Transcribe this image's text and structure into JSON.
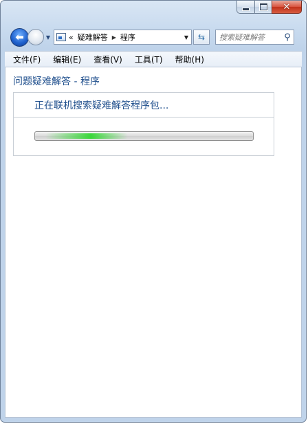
{
  "address": {
    "overflow": "«",
    "crumbs": [
      "疑难解答",
      "程序"
    ]
  },
  "search": {
    "placeholder": "搜索疑难解答"
  },
  "menu": {
    "items": [
      "文件(F)",
      "编辑(E)",
      "查看(V)",
      "工具(T)",
      "帮助(H)"
    ]
  },
  "content": {
    "title": "问题疑难解答 - 程序",
    "status": "正在联机搜索疑难解答程序包..."
  },
  "progress": {
    "mode": "indeterminate",
    "glow_position": 0.2
  },
  "colors": {
    "link_blue": "#1e4e8c",
    "progress_glow": "#32d732",
    "close_red": "#c2321b"
  }
}
